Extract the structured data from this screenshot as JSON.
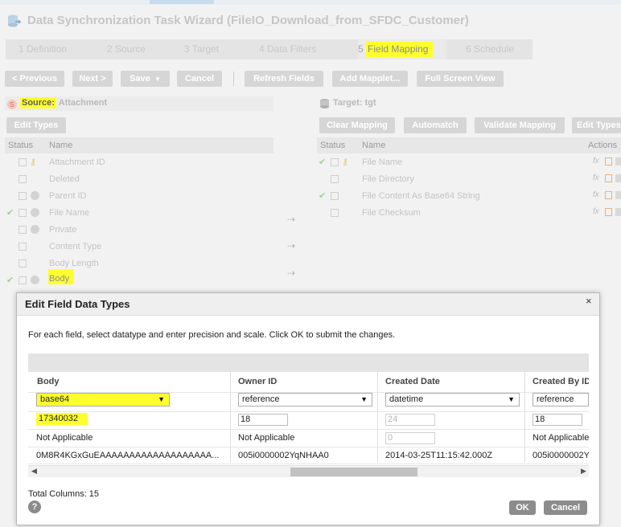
{
  "window": {
    "title": "Data Synchronization Task Wizard (FileIO_Download_from_SFDC_Customer)"
  },
  "steps": [
    {
      "label": "1 Definition"
    },
    {
      "label": "2 Source"
    },
    {
      "label": "3 Target"
    },
    {
      "label": "4 Data Filters"
    },
    {
      "label": "5"
    },
    {
      "label": "Field Mapping"
    },
    {
      "label": "6 Schedule"
    }
  ],
  "toolbar": {
    "previous": "< Previous",
    "next": "Next >",
    "save": "Save",
    "cancel": "Cancel",
    "refresh": "Refresh Fields",
    "add_mapplet": "Add Mapplet...",
    "full_screen": "Full Screen View"
  },
  "source": {
    "label_prefix": "Source:",
    "label_value": "Attachment",
    "edit_types": "Edit Types",
    "col_status": "Status",
    "col_name": "Name",
    "fields": [
      "Attachment ID",
      "Deleted",
      "Parent ID",
      "File Name",
      "Private",
      "Content Type",
      "Body Length",
      "Body"
    ]
  },
  "target": {
    "label": "Target: tgt",
    "clear_mapping": "Clear Mapping",
    "automatch": "Automatch",
    "validate_mapping": "Validate Mapping",
    "edit_types": "Edit Types",
    "col_status": "Status",
    "col_name": "Name",
    "col_actions": "Actions",
    "fields": [
      "File Name",
      "File Directory",
      "File Content As Base64 String",
      "File Checksum"
    ]
  },
  "modal": {
    "title": "Edit Field Data Types",
    "close": "×",
    "instructions": "For each field, select datatype and enter precision and scale. Click OK to submit the changes.",
    "columns": [
      "Body",
      "Owner ID",
      "Created Date",
      "Created By ID"
    ],
    "datatypes": [
      "base64",
      "reference",
      "datetime",
      "reference"
    ],
    "precision": [
      "17340032",
      "18",
      "24",
      "18"
    ],
    "scale": [
      "Not Applicable",
      "Not Applicable",
      "0",
      "Not Applicable"
    ],
    "sample": [
      "0M8R4KGxGuEAAAAAAAAAAAAAAAAAAA...",
      "005i0000002YqNHAA0",
      "2014-03-25T11:15:42.000Z",
      "005i0000002Y"
    ],
    "total_columns": "Total Columns: 15",
    "help": "?",
    "ok": "OK",
    "cancel": "Cancel"
  }
}
